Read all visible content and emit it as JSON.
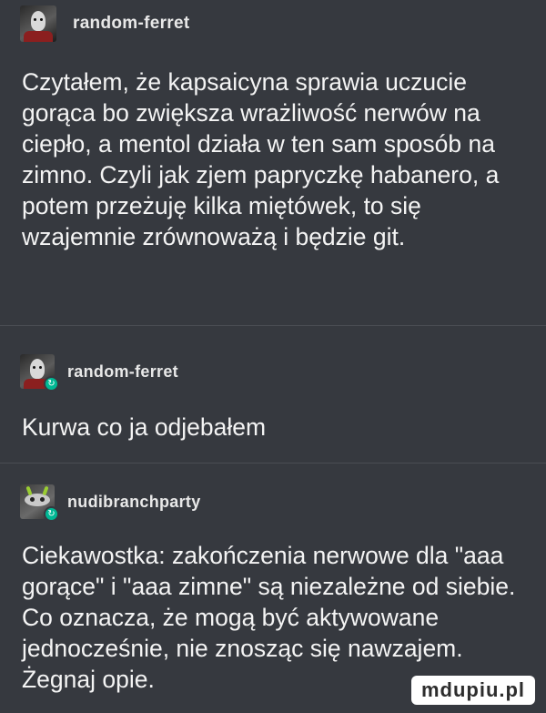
{
  "posts": [
    {
      "username": "random-ferret",
      "avatar_icon": "ferret-avatar-icon",
      "text": "Czytałem, że kapsaicyna sprawia uczucie gorąca bo zwiększa wrażliwość nerwów na ciepło, a mentol działa w ten sam sposób na zimno. Czyli jak zjem papryczkę habanero, a potem przeżuję kilka miętówek, to się wzajemnie zrównoważą i będzie git."
    },
    {
      "username": "random-ferret",
      "avatar_icon": "ferret-avatar-icon",
      "badge_icon": "reblog-badge-icon",
      "text": "Kurwa co ja odjebałem"
    },
    {
      "username": "nudibranchparty",
      "avatar_icon": "nudibranch-avatar-icon",
      "badge_icon": "reblog-badge-icon",
      "text": "Ciekawostka: zakończenia nerwowe dla \"aaa gorące\" i \"aaa zimne\" są niezależne od siebie. Co oznacza, że mogą być aktywowane jednocześnie, nie znosząc się nawzajem. Żegnaj opie."
    }
  ],
  "watermark": "mdupiu.pl"
}
